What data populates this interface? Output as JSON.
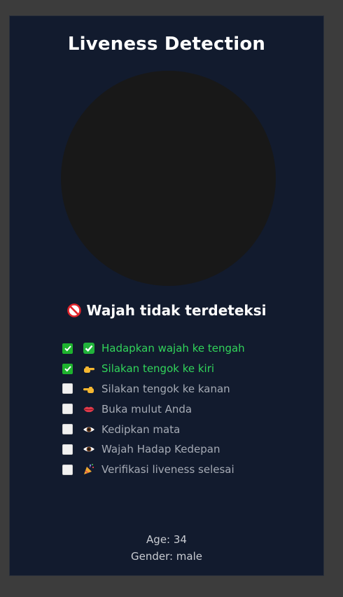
{
  "title": "Liveness Detection",
  "status": {
    "icon": "prohibited-icon",
    "text": "Wajah tidak terdeteksi"
  },
  "steps": [
    {
      "checked": true,
      "icon": "check-mark-emoji-icon",
      "label": "Hadapkan wajah ke tengah"
    },
    {
      "checked": true,
      "icon": "pointing-right-emoji-icon",
      "label": "Silakan tengok ke kiri"
    },
    {
      "checked": false,
      "icon": "pointing-left-emoji-icon",
      "label": "Silakan tengok ke kanan"
    },
    {
      "checked": false,
      "icon": "lips-emoji-icon",
      "label": "Buka mulut Anda"
    },
    {
      "checked": false,
      "icon": "eye-emoji-icon",
      "label": "Kedipkan mata"
    },
    {
      "checked": false,
      "icon": "eye-emoji-icon",
      "label": "Wajah Hadap Kedepan"
    },
    {
      "checked": false,
      "icon": "party-popper-emoji-icon",
      "label": "Verifikasi liveness selesai"
    }
  ],
  "info": {
    "age": "Age: 34",
    "gender": "Gender: male"
  },
  "colors": {
    "panel_bg": "#121b2e",
    "done_text": "#31d45a",
    "todo_text": "#a6abb5",
    "checkbox_on": "#1eb32e"
  }
}
